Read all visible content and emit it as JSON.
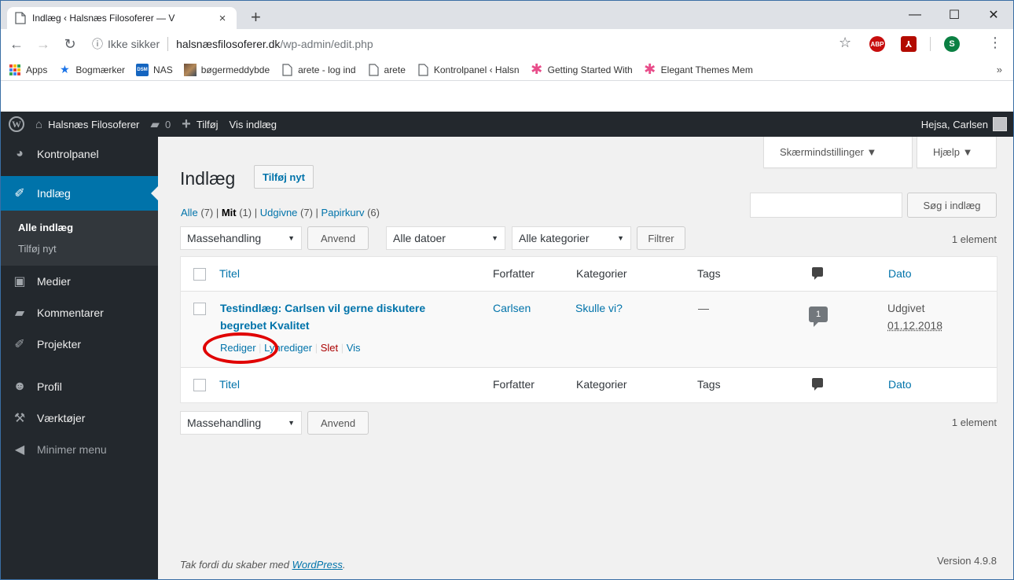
{
  "browser": {
    "tab_title": "Indlæg ‹ Halsnæs Filosoferer — V",
    "tab_close": "×",
    "new_tab": "+",
    "win_min": "—",
    "win_max": "☐",
    "win_close": "✕",
    "insecure_label": "Ikke sikker",
    "url_host": "halsnæsfilosoferer.dk",
    "url_path": "/wp-admin/edit.php",
    "ext_abp": "ABP",
    "ext_pdf": "⅄",
    "ext_s": "S",
    "bookmarks": [
      {
        "label": "Apps",
        "icon": "apps-icon"
      },
      {
        "label": "Bogmærker",
        "icon": "star-icon"
      },
      {
        "label": "NAS",
        "icon": "dsm-icon"
      },
      {
        "label": "bøgermeddybde",
        "icon": "image-icon"
      },
      {
        "label": "arete - log ind",
        "icon": "page-icon"
      },
      {
        "label": "arete",
        "icon": "page-icon"
      },
      {
        "label": "Kontrolpanel ‹ Halsn",
        "icon": "page-icon"
      },
      {
        "label": "Getting Started With",
        "icon": "asterisk-icon"
      },
      {
        "label": "Elegant Themes Mem",
        "icon": "asterisk-icon"
      }
    ],
    "bookmarks_more": "»",
    "dsm_text": "DSM"
  },
  "adminbar": {
    "site_name": "Halsnæs Filosoferer",
    "comments_count": "0",
    "add_new": "Tilføj",
    "view_posts": "Vis indlæg",
    "greeting": "Hejsa, Carlsen"
  },
  "sidebar": {
    "dashboard": "Kontrolpanel",
    "posts": "Indlæg",
    "sub_all": "Alle indlæg",
    "sub_add": "Tilføj nyt",
    "media": "Medier",
    "comments": "Kommentarer",
    "projects": "Projekter",
    "profile": "Profil",
    "tools": "Værktøjer",
    "collapse": "Minimer menu"
  },
  "main": {
    "screen_options": "Skærmindstillinger ▼",
    "help": "Hjælp ▼",
    "title": "Indlæg",
    "add_new": "Tilføj nyt",
    "filters": {
      "all": "Alle",
      "all_count": "(7)",
      "mine": "Mit",
      "mine_count": "(1)",
      "published": "Udgivne",
      "published_count": "(7)",
      "trash": "Papirkurv",
      "trash_count": "(6)"
    },
    "search_button": "Søg i indlæg",
    "bulk_action": "Massehandling",
    "apply": "Anvend",
    "all_dates": "Alle datoer",
    "all_categories": "Alle kategorier",
    "filter": "Filtrer",
    "item_count": "1 element",
    "columns": {
      "title": "Titel",
      "author": "Forfatter",
      "categories": "Kategorier",
      "tags": "Tags",
      "date": "Dato"
    },
    "rows": [
      {
        "title_line1": "Testindlæg: Carlsen vil gerne diskutere",
        "title_line2": "begrebet Kvalitet",
        "author": "Carlsen",
        "category": "Skulle vi?",
        "tags": "—",
        "comments": "1",
        "date_status": "Udgivet",
        "date": "01.12.2018",
        "actions": {
          "edit": "Rediger",
          "quick_edit": "Lynrediger",
          "trash": "Slet",
          "view": "Vis"
        }
      }
    ],
    "footer_thanks_prefix": "Tak fordi du skaber med ",
    "footer_thanks_link": "WordPress",
    "footer_thanks_suffix": ".",
    "version": "Version 4.9.8"
  }
}
